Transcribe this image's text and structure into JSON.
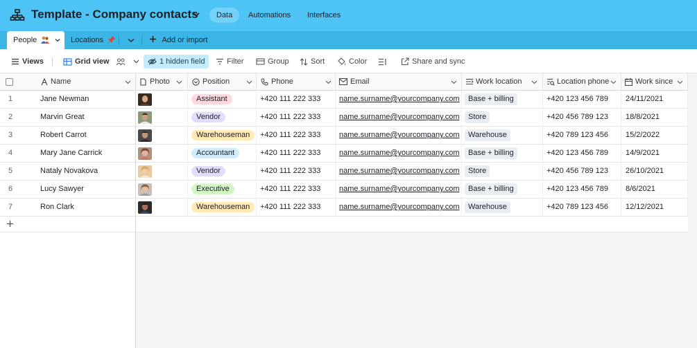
{
  "header": {
    "title": "Template - Company contacts",
    "tabs": [
      {
        "label": "Data",
        "active": true
      },
      {
        "label": "Automations",
        "active": false
      },
      {
        "label": "Interfaces",
        "active": false
      }
    ]
  },
  "tables": {
    "items": [
      {
        "label": "People",
        "icon": "people-emoji",
        "active": true
      },
      {
        "label": "Locations",
        "icon": "pushpin-emoji",
        "active": false
      }
    ],
    "add_label": "Add or import"
  },
  "toolbar": {
    "views_label": "Views",
    "grid_view_label": "Grid view",
    "hidden_field_label": "1 hidden field",
    "filter_label": "Filter",
    "group_label": "Group",
    "sort_label": "Sort",
    "color_label": "Color",
    "share_label": "Share and sync"
  },
  "columns": {
    "name": "Name",
    "photo": "Photo",
    "position": "Position",
    "phone": "Phone",
    "email": "Email",
    "work_location": "Work location",
    "location_phone": "Location phone",
    "work_since": "Work since"
  },
  "rows": [
    {
      "num": "1",
      "name": "Jane Newman",
      "position": "Assistant",
      "position_color": "#ffd9e0",
      "phone": "+420 111 222 333",
      "email": "name.surname@yourcompany.com",
      "location": "Base + billing",
      "location_phone": "+420 123 456 789",
      "since": "24/11/2021"
    },
    {
      "num": "2",
      "name": "Marvin Great",
      "position": "Vendor",
      "position_color": "#e3dcfa",
      "phone": "+420 111 222 333",
      "email": "name.surname@yourcompany.com",
      "location": "Store",
      "location_phone": "+420 456 789 123",
      "since": "18/8/2021"
    },
    {
      "num": "3",
      "name": "Robert Carrot",
      "position": "Warehouseman",
      "position_color": "#ffeab6",
      "phone": "+420 111 222 333",
      "email": "name.surname@yourcompany.com",
      "location": "Warehouse",
      "location_phone": "+420 789 123 456",
      "since": "15/2/2022"
    },
    {
      "num": "4",
      "name": "Mary Jane Carrick",
      "position": "Accountant",
      "position_color": "#cfedfc",
      "phone": "+420 111 222 333",
      "email": "name.surname@yourcompany.com",
      "location": "Base + billing",
      "location_phone": "+420 123 456 789",
      "since": "14/9/2021"
    },
    {
      "num": "5",
      "name": "Nataly Novakova",
      "position": "Vendor",
      "position_color": "#e3dcfa",
      "phone": "+420 111 222 333",
      "email": "name.surname@yourcompany.com",
      "location": "Store",
      "location_phone": "+420 456 789 123",
      "since": "26/10/2021"
    },
    {
      "num": "6",
      "name": "Lucy Sawyer",
      "position": "Executive",
      "position_color": "#d1f7c4",
      "phone": "+420 111 222 333",
      "email": "name.surname@yourcompany.com",
      "location": "Base + billing",
      "location_phone": "+420 123 456 789",
      "since": "8/6/2021"
    },
    {
      "num": "7",
      "name": "Ron Clark",
      "position": "Warehouseman",
      "position_color": "#ffeab6",
      "phone": "+420 111 222 333",
      "email": "name.surname@yourcompany.com",
      "location": "Warehouse",
      "location_phone": "+420 789 123 456",
      "since": "12/12/2021"
    }
  ],
  "colors": {
    "header_bg": "#4dc4f5",
    "tablebar_bg": "#3bb4e6",
    "hidden_field_bg": "#c4ecff"
  }
}
